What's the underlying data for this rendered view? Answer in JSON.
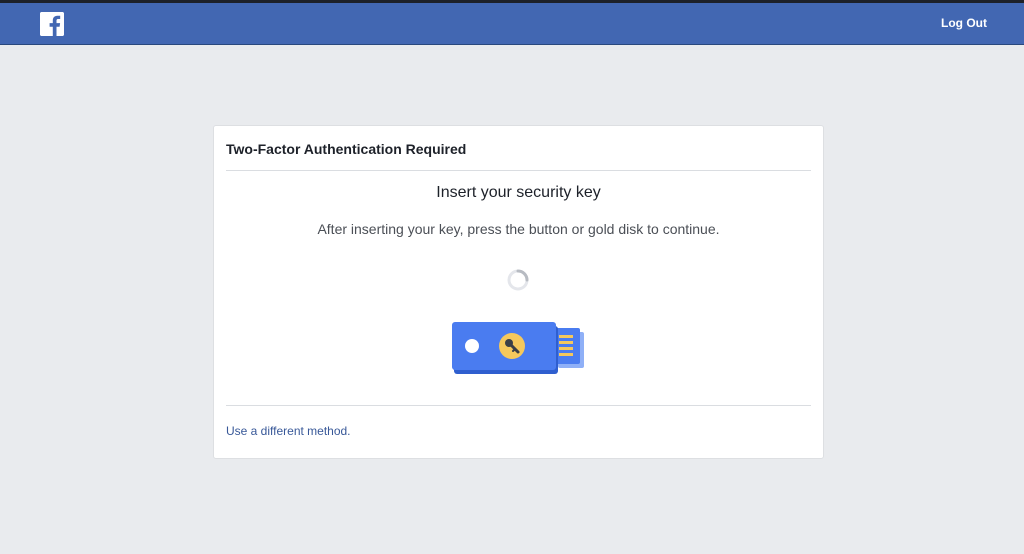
{
  "header": {
    "logo_icon": "facebook-f-icon",
    "logout_label": "Log Out",
    "brand_color": "#4267b2"
  },
  "card": {
    "title": "Two-Factor Authentication Required",
    "heading": "Insert your security key",
    "instructions": "After inserting your key, press the button or gold disk to continue.",
    "spinner_icon": "loading-spinner-icon",
    "illustration_icon": "usb-security-key-icon",
    "alternate_link": "Use a different method."
  },
  "colors": {
    "page_background": "#e9ebee",
    "link": "#385898",
    "key_blue": "#4a7cf0",
    "key_gold": "#f5c85c"
  }
}
